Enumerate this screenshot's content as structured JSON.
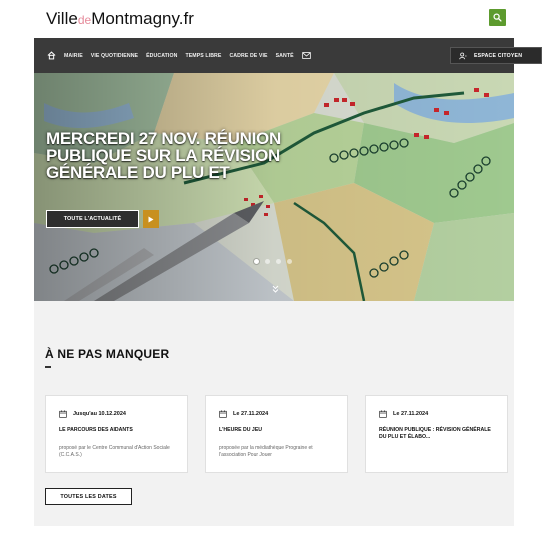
{
  "header": {
    "logo_part1": "Ville",
    "logo_part2": "de",
    "logo_part3": "Montmagny.fr",
    "search_icon": "search-icon"
  },
  "nav": {
    "home_icon": "home-icon",
    "items": [
      "Mairie",
      "Vie quotidienne",
      "Éducation",
      "Temps libre",
      "Cadre de vie",
      "Santé"
    ],
    "mail_icon": "mail-icon",
    "espace_label": "ESPACE CITOYEN",
    "espace_icon": "user-icon"
  },
  "hero": {
    "title": "MERCREDI 27 NOV. RÉUNION PUBLIQUE SUR LA RÉVISION GÉNÉRALE DU PLU ET",
    "button_label": "TOUTE L'ACTUALITÉ",
    "play_icon": "play-icon",
    "slides": 4,
    "active_slide": 1,
    "scroll_icon": "chevron-double-down-icon"
  },
  "section": {
    "title": "À NE PAS MANQUER",
    "cards": [
      {
        "date": "Jusqu'au 10.12.2024",
        "title": "LE PARCOURS DES AIDANTS",
        "desc": "proposé par le Centre Communal d'Action Sociale (C.C.A.S.)"
      },
      {
        "date": "Le 27.11.2024",
        "title": "L'HEURE DU JEU",
        "desc": "proposée par la médiathèque Prograine et l'association Pour Jouer"
      },
      {
        "date": "Le 27.11.2024",
        "title": "RÉUNION PUBLIQUE : RÉVISION GÉNÉRALE DU PLU ET ÉLABO...",
        "desc": ""
      }
    ],
    "all_dates_label": "TOUTES LES DATES",
    "calendar_icon": "calendar-icon"
  },
  "colors": {
    "accent_green": "#5d9b2e",
    "nav_bg": "#3a3a3a",
    "button_orange": "#c8901f",
    "section_bg": "#f2f2f2"
  }
}
